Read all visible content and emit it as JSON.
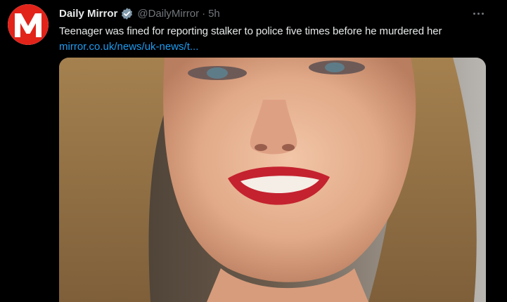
{
  "tweet": {
    "author": {
      "display_name": "Daily Mirror",
      "handle": "@DailyMirror",
      "avatar_letter": "M",
      "verified": true
    },
    "separator": "·",
    "time": "5h",
    "text": "Teenager was fined for reporting stalker to police five times before he murdered her",
    "link_text": "mirror.co.uk/news/uk-news/t...",
    "media_description_icon": "photo"
  },
  "colors": {
    "background": "#000000",
    "primary_text": "#e7e9ea",
    "secondary_text": "#71767b",
    "link": "#1d9bf0",
    "brand_red": "#e2231a",
    "verified_badge": "#829aab"
  }
}
